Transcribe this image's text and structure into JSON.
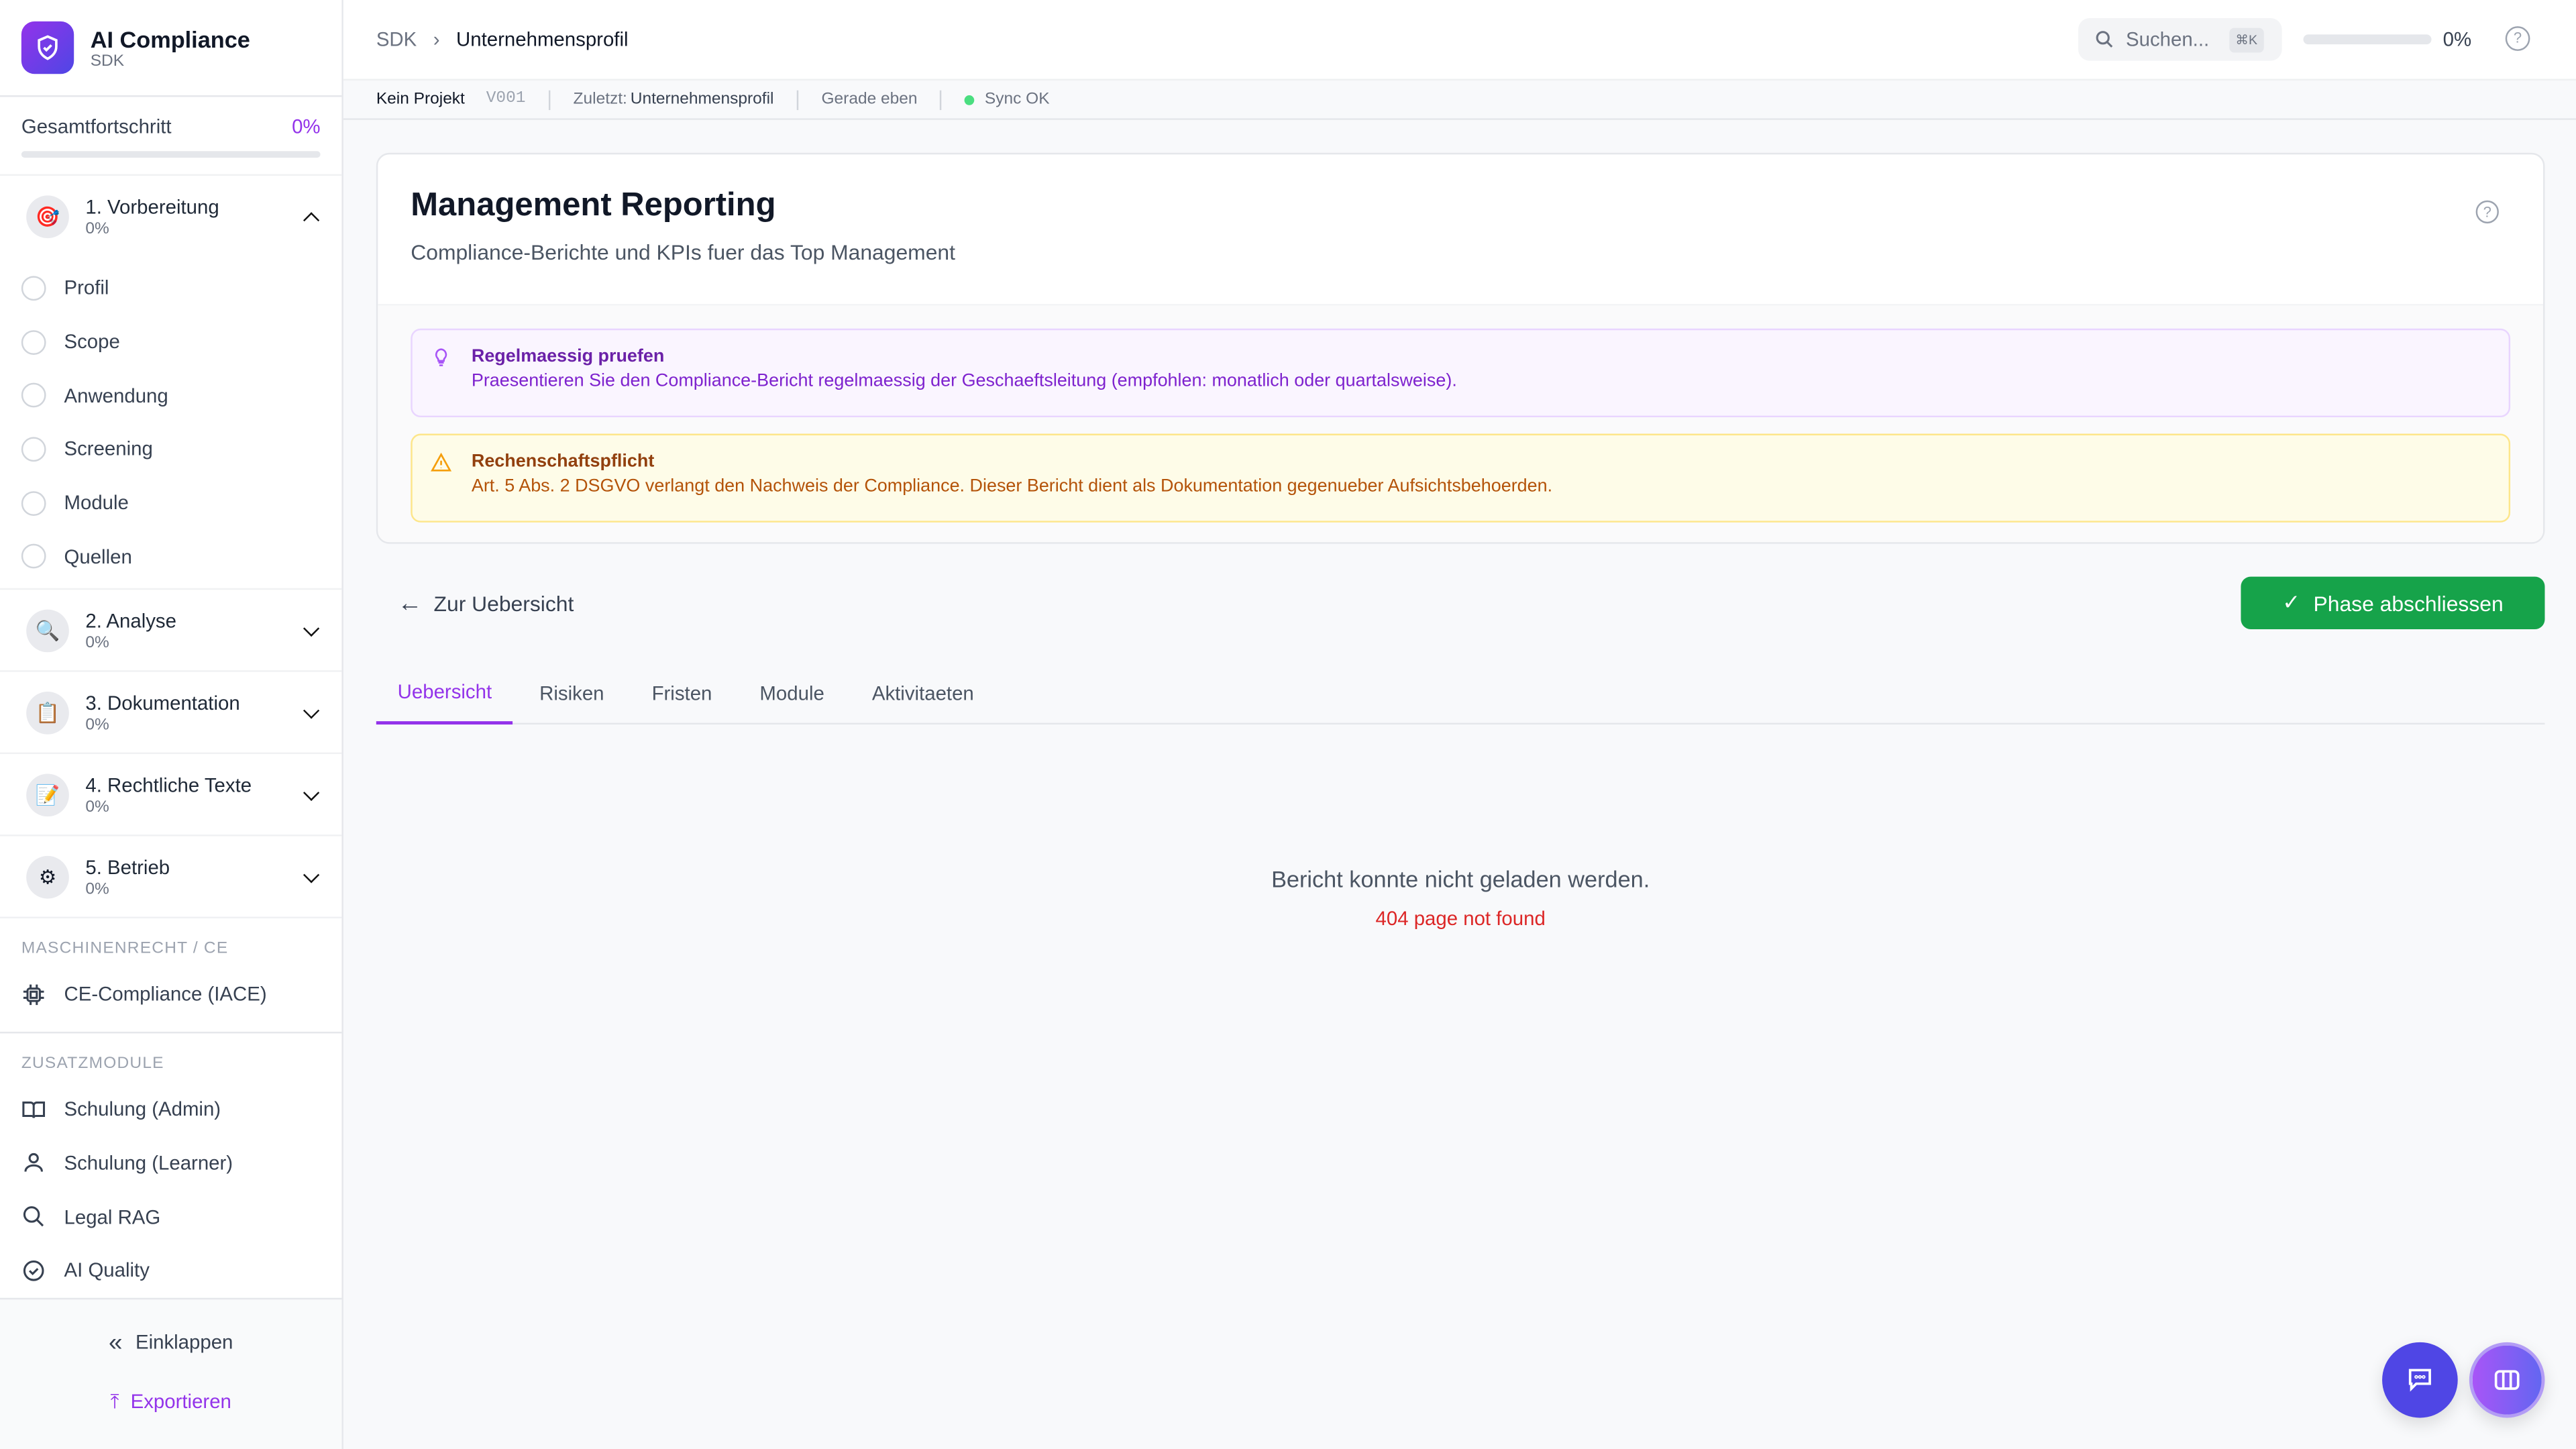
{
  "app": {
    "title": "AI Compliance",
    "subtitle": "SDK"
  },
  "progress": {
    "label": "Gesamtfortschritt",
    "value": "0%",
    "fraction": 0
  },
  "phases": [
    {
      "title": "1. Vorbereitung",
      "pct": "0%",
      "icon": "target-icon",
      "expanded": true,
      "items": [
        "Profil",
        "Scope",
        "Anwendung",
        "Screening",
        "Module",
        "Quellen"
      ]
    },
    {
      "title": "2. Analyse",
      "pct": "0%",
      "icon": "magnifier-icon"
    },
    {
      "title": "3. Dokumentation",
      "pct": "0%",
      "icon": "clipboard-icon"
    },
    {
      "title": "4. Rechtliche Texte",
      "pct": "0%",
      "icon": "pencil-memo-icon"
    },
    {
      "title": "5. Betrieb",
      "pct": "0%",
      "icon": "gear-icon"
    }
  ],
  "sections": [
    {
      "title": "MASCHINENRECHT / CE",
      "items": [
        "CE-Compliance (IACE)"
      ]
    },
    {
      "title": "ZUSATZMODULE",
      "items": [
        "Schulung (Admin)",
        "Schulung (Learner)",
        "Legal RAG",
        "AI Quality"
      ]
    }
  ],
  "footer": {
    "collapse": "Einklappen",
    "export": "Exportieren"
  },
  "header": {
    "breadcrumb": [
      "SDK",
      "Unternehmensprofil"
    ],
    "search_placeholder": "Suchen...",
    "shortcut": "⌘K",
    "progress": "0%"
  },
  "statusbar": {
    "project": "Kein Projekt",
    "version": "V001",
    "last": "Zuletzt: ",
    "last_value": "Unternehmensprofil",
    "time": "Gerade eben",
    "sync": "Sync OK"
  },
  "card": {
    "title": "Management Reporting",
    "subtitle": "Compliance-Berichte und KPIs fuer das Top Management",
    "tip": {
      "title": "Regelmaessig pruefen",
      "text": "Praesentieren Sie den Compliance-Bericht regelmaessig der Geschaeftsleitung (empfohlen: monatlich oder quartalsweise)."
    },
    "warning": {
      "title": "Rechenschaftspflicht",
      "text": "Art. 5 Abs. 2 DSGVO verlangt den Nachweis der Compliance. Dieser Bericht dient als Dokumentation gegenueber Aufsichtsbehoerden."
    }
  },
  "back": "Zur Uebersicht",
  "complete": "Phase abschliessen",
  "tabs": [
    "Uebersicht",
    "Risiken",
    "Fristen",
    "Module",
    "Aktivitaeten"
  ],
  "error": {
    "message": "Bericht konnte nicht geladen werden.",
    "detail": "404 page not found"
  },
  "colors": {
    "accent": "#9333ea",
    "success": "#16a34a",
    "error": "#dc2626"
  }
}
